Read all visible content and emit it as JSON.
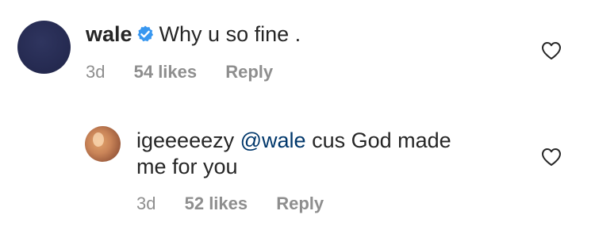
{
  "comments": [
    {
      "username": "wale",
      "verified": true,
      "text": "Why u so fine .",
      "age": "3d",
      "likes": "54 likes",
      "reply_label": "Reply"
    }
  ],
  "replies": [
    {
      "username": "igeeeeezy",
      "mention": "@wale",
      "text_line1": "cus God made",
      "text_line2": "me for you",
      "age": "3d",
      "likes": "52 likes",
      "reply_label": "Reply"
    }
  ],
  "icons": {
    "like": "heart-outline-icon",
    "verified": "verified-badge-icon"
  },
  "colors": {
    "text": "#262626",
    "meta": "#8e8e8e",
    "mention": "#00376b",
    "verified": "#3897f0"
  }
}
